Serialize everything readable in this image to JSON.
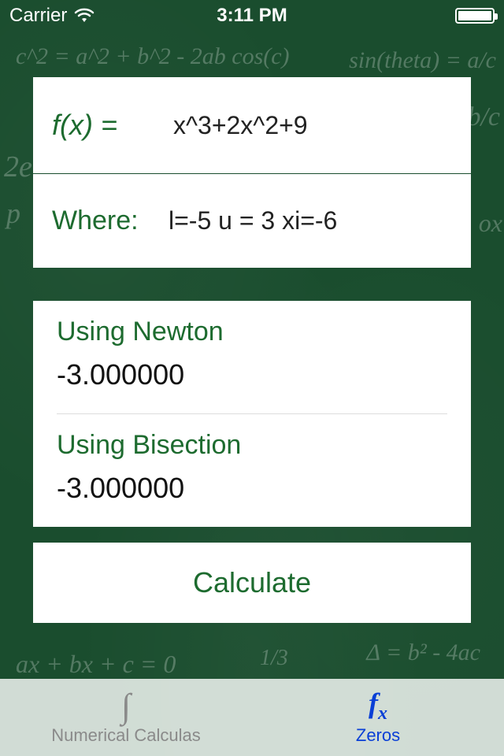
{
  "status": {
    "carrier": "Carrier",
    "time": "3:11 PM"
  },
  "inputs": {
    "fx_label": "f(x) =",
    "fx_value": "x^3+2x^2+9",
    "where_label": "Where:",
    "where_value": "l=-5 u = 3 xi=-6"
  },
  "results": {
    "newton_label": "Using Newton",
    "newton_value": "-3.000000",
    "bisection_label": "Using Bisection",
    "bisection_value": "-3.000000"
  },
  "actions": {
    "calculate_label": "Calculate"
  },
  "tabs": {
    "numerical_label": "Numerical Calculas",
    "zeros_label": "Zeros"
  },
  "chalk": {
    "l1": "c^2 = a^2 + b^2 - 2ab cos(c)",
    "l2": "sin(theta) = a/c",
    "l3": "2e",
    "l4": "b/c",
    "l5": "p",
    "l6": "ox",
    "l7": "ax + bx + c = 0",
    "l8": "Δ = b² - 4ac",
    "l9": "1/3"
  }
}
